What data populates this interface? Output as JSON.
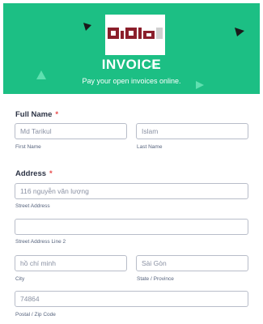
{
  "header": {
    "logo_text": "biblio",
    "title": "INVOICE",
    "subtitle": "Pay your open invoices online."
  },
  "colors": {
    "header_bg": "#1cbf84",
    "logo_brand": "#8b1e2b",
    "required": "#e84b4b",
    "field_border": "#b8bdc9"
  },
  "form": {
    "full_name": {
      "label": "Full Name",
      "required_mark": "*",
      "first": {
        "value": "Md Tarikul",
        "sublabel": "First Name"
      },
      "last": {
        "value": "Islam",
        "sublabel": "Last Name"
      }
    },
    "address": {
      "label": "Address",
      "required_mark": "*",
      "street": {
        "value": "116 nguyễn văn lượng",
        "sublabel": "Street Address"
      },
      "street2": {
        "value": "",
        "sublabel": "Street Address Line 2"
      },
      "city": {
        "value": "hồ chí minh",
        "sublabel": "City"
      },
      "state": {
        "value": "Sài Gòn",
        "sublabel": "State / Province"
      },
      "postal": {
        "value": "74864",
        "sublabel": "Postal / Zip Code"
      }
    }
  }
}
